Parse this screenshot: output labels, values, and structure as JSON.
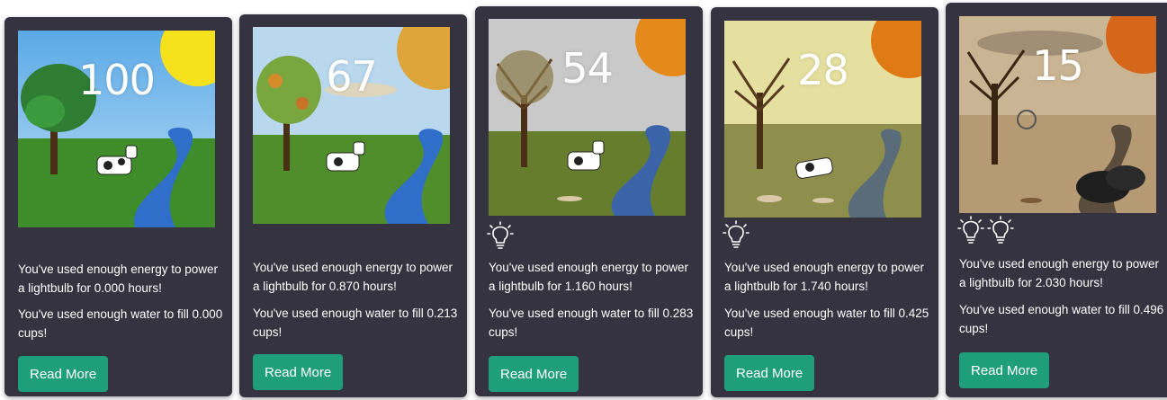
{
  "cards": [
    {
      "score": "100",
      "bulbs": 0,
      "energy_text": "You've used enough energy to power a lightbulb for 0.000 hours!",
      "water_text": "You've used enough water to fill 0.000 cups!",
      "button_label": "Read More"
    },
    {
      "score": "67",
      "bulbs": 0,
      "energy_text": "You've used enough energy to power a lightbulb for 0.870 hours!",
      "water_text": "You've used enough water to fill 0.213 cups!",
      "button_label": "Read More"
    },
    {
      "score": "54",
      "bulbs": 1,
      "energy_text": "You've used enough energy to power a lightbulb for 1.160 hours!",
      "water_text": "You've used enough water to fill 0.283 cups!",
      "button_label": "Read More"
    },
    {
      "score": "28",
      "bulbs": 1,
      "energy_text": "You've used enough energy to power a lightbulb for 1.740 hours!",
      "water_text": "You've used enough water to fill 0.425 cups!",
      "button_label": "Read More"
    },
    {
      "score": "15",
      "bulbs": 2,
      "energy_text": "You've used enough energy to power a lightbulb for 2.030 hours!",
      "water_text": "You've used enough water to fill 0.496 cups!",
      "button_label": "Read More"
    }
  ],
  "colors": {
    "card_bg": "#34333f",
    "button_bg": "#1f9e7a",
    "text": "#ffffff"
  }
}
